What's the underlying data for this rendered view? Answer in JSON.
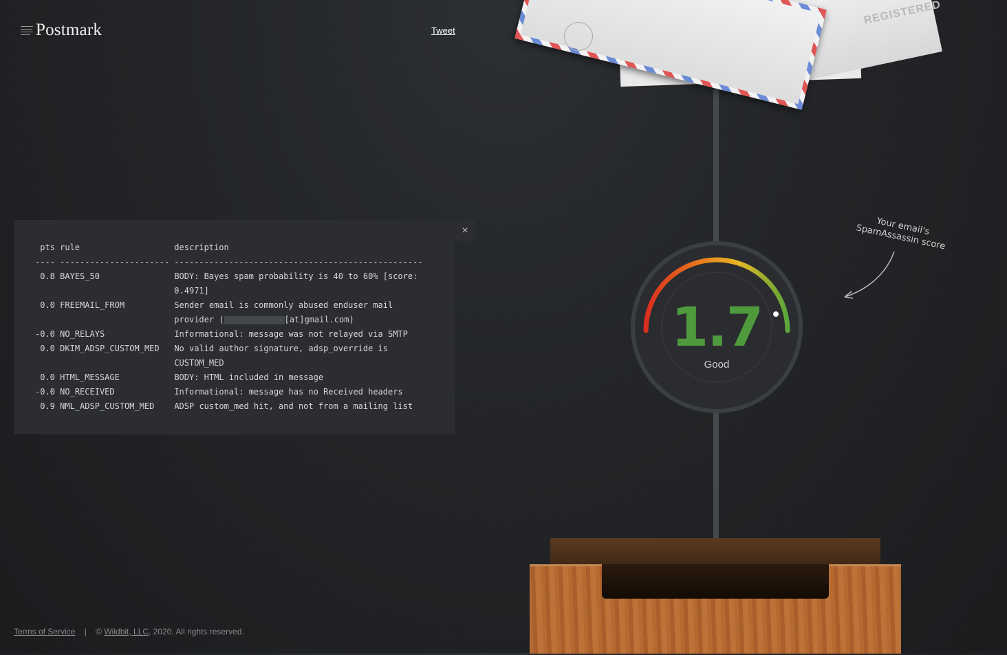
{
  "brand": {
    "name": "Postmark"
  },
  "header": {
    "tweet_label": "Tweet"
  },
  "report": {
    "close_label": "×",
    "header_line": " pts rule                   description",
    "divider_line": "---- ---------------------- --------------------------------------------------",
    "rows": [
      {
        "pts": " 0.8",
        "rule": "BAYES_50",
        "desc1": "BODY: Bayes spam probability is 40 to 60% [score:",
        "desc2": "0.4971]"
      },
      {
        "pts": " 0.0",
        "rule": "FREEMAIL_FROM",
        "desc1": "Sender email is commonly abused enduser mail",
        "desc2_prefix": "provider (",
        "desc2_suffix": "[at]gmail.com)"
      },
      {
        "pts": "-0.0",
        "rule": "NO_RELAYS",
        "desc1": "Informational: message was not relayed via SMTP"
      },
      {
        "pts": " 0.0",
        "rule": "DKIM_ADSP_CUSTOM_MED",
        "desc1": "No valid author signature, adsp_override is",
        "desc2": "CUSTOM_MED"
      },
      {
        "pts": " 0.0",
        "rule": "HTML_MESSAGE",
        "desc1": "BODY: HTML included in message"
      },
      {
        "pts": "-0.0",
        "rule": "NO_RECEIVED",
        "desc1": "Informational: message has no Received headers"
      },
      {
        "pts": " 0.9",
        "rule": "NML_ADSP_CUSTOM_MED",
        "desc1": "ADSP custom_med hit, and not from a mailing list"
      }
    ]
  },
  "gauge": {
    "score": "1.7",
    "verdict": "Good",
    "score_color": "#4f9a3d"
  },
  "hint": {
    "line1": "Your email's",
    "line2": "SpamAssassin score"
  },
  "envelope": {
    "registered_text": "REGISTERED"
  },
  "footer": {
    "terms_label": "Terms of Service",
    "separator": "|",
    "copyright_prefix": "©",
    "company_link": "Wildbit, LLC",
    "copyright_suffix": ", 2020. All rights reserved."
  }
}
